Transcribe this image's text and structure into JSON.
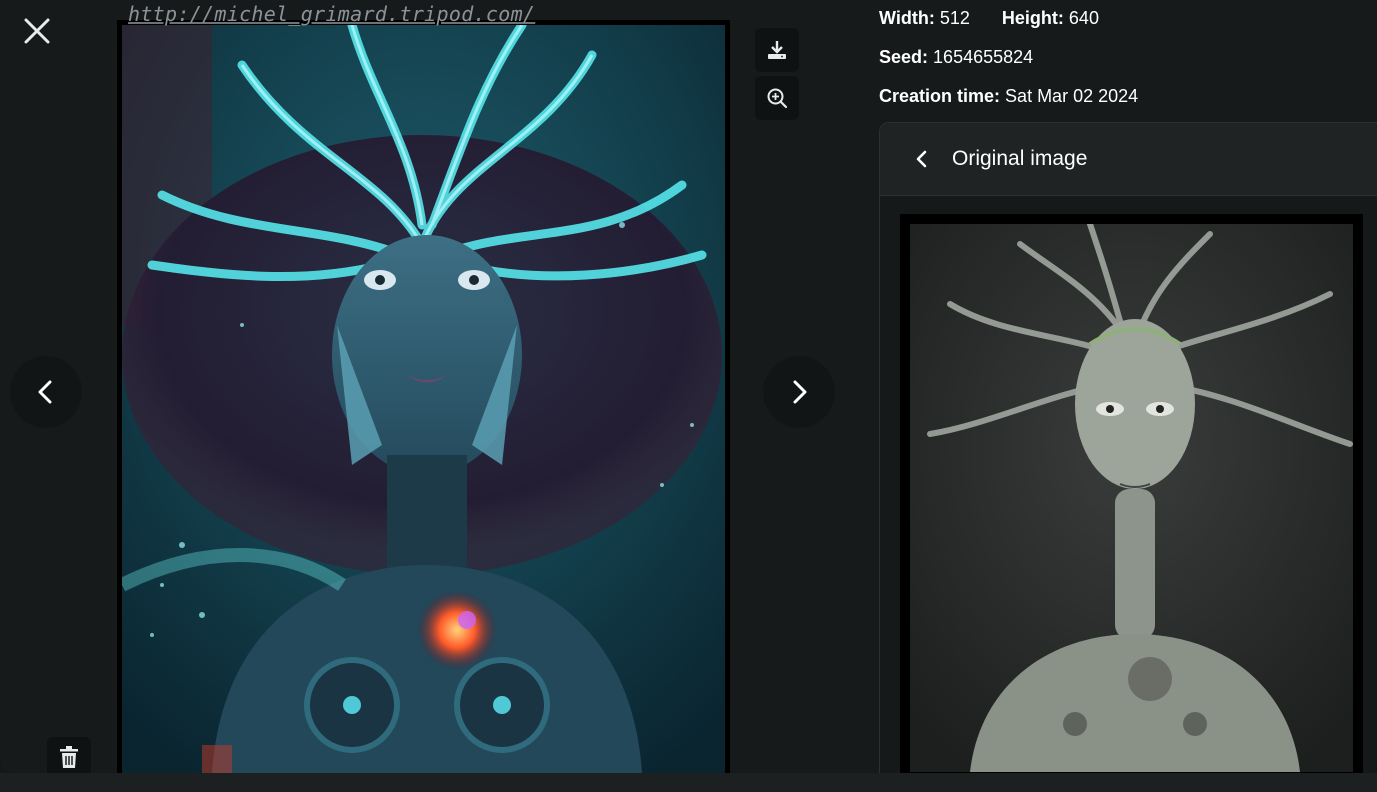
{
  "viewer": {
    "watermark": "http://michel_grimard.tripod.com/",
    "icons": {
      "close": "close-icon",
      "prev": "chevron-left-icon",
      "next": "chevron-right-icon",
      "download": "download-icon",
      "zoom": "zoom-in-icon",
      "delete": "trash-icon"
    }
  },
  "details": {
    "width_label": "Width:",
    "width_value": "512",
    "height_label": "Height:",
    "height_value": "640",
    "seed_label": "Seed:",
    "seed_value": "1654655824",
    "creation_label": "Creation time:",
    "creation_value": "Sat Mar 02 2024"
  },
  "original_panel": {
    "title": "Original image",
    "back_icon": "chevron-left-icon"
  },
  "colors": {
    "background": "#161a1b",
    "panel": "#1f2324",
    "button": "#0f1213"
  }
}
